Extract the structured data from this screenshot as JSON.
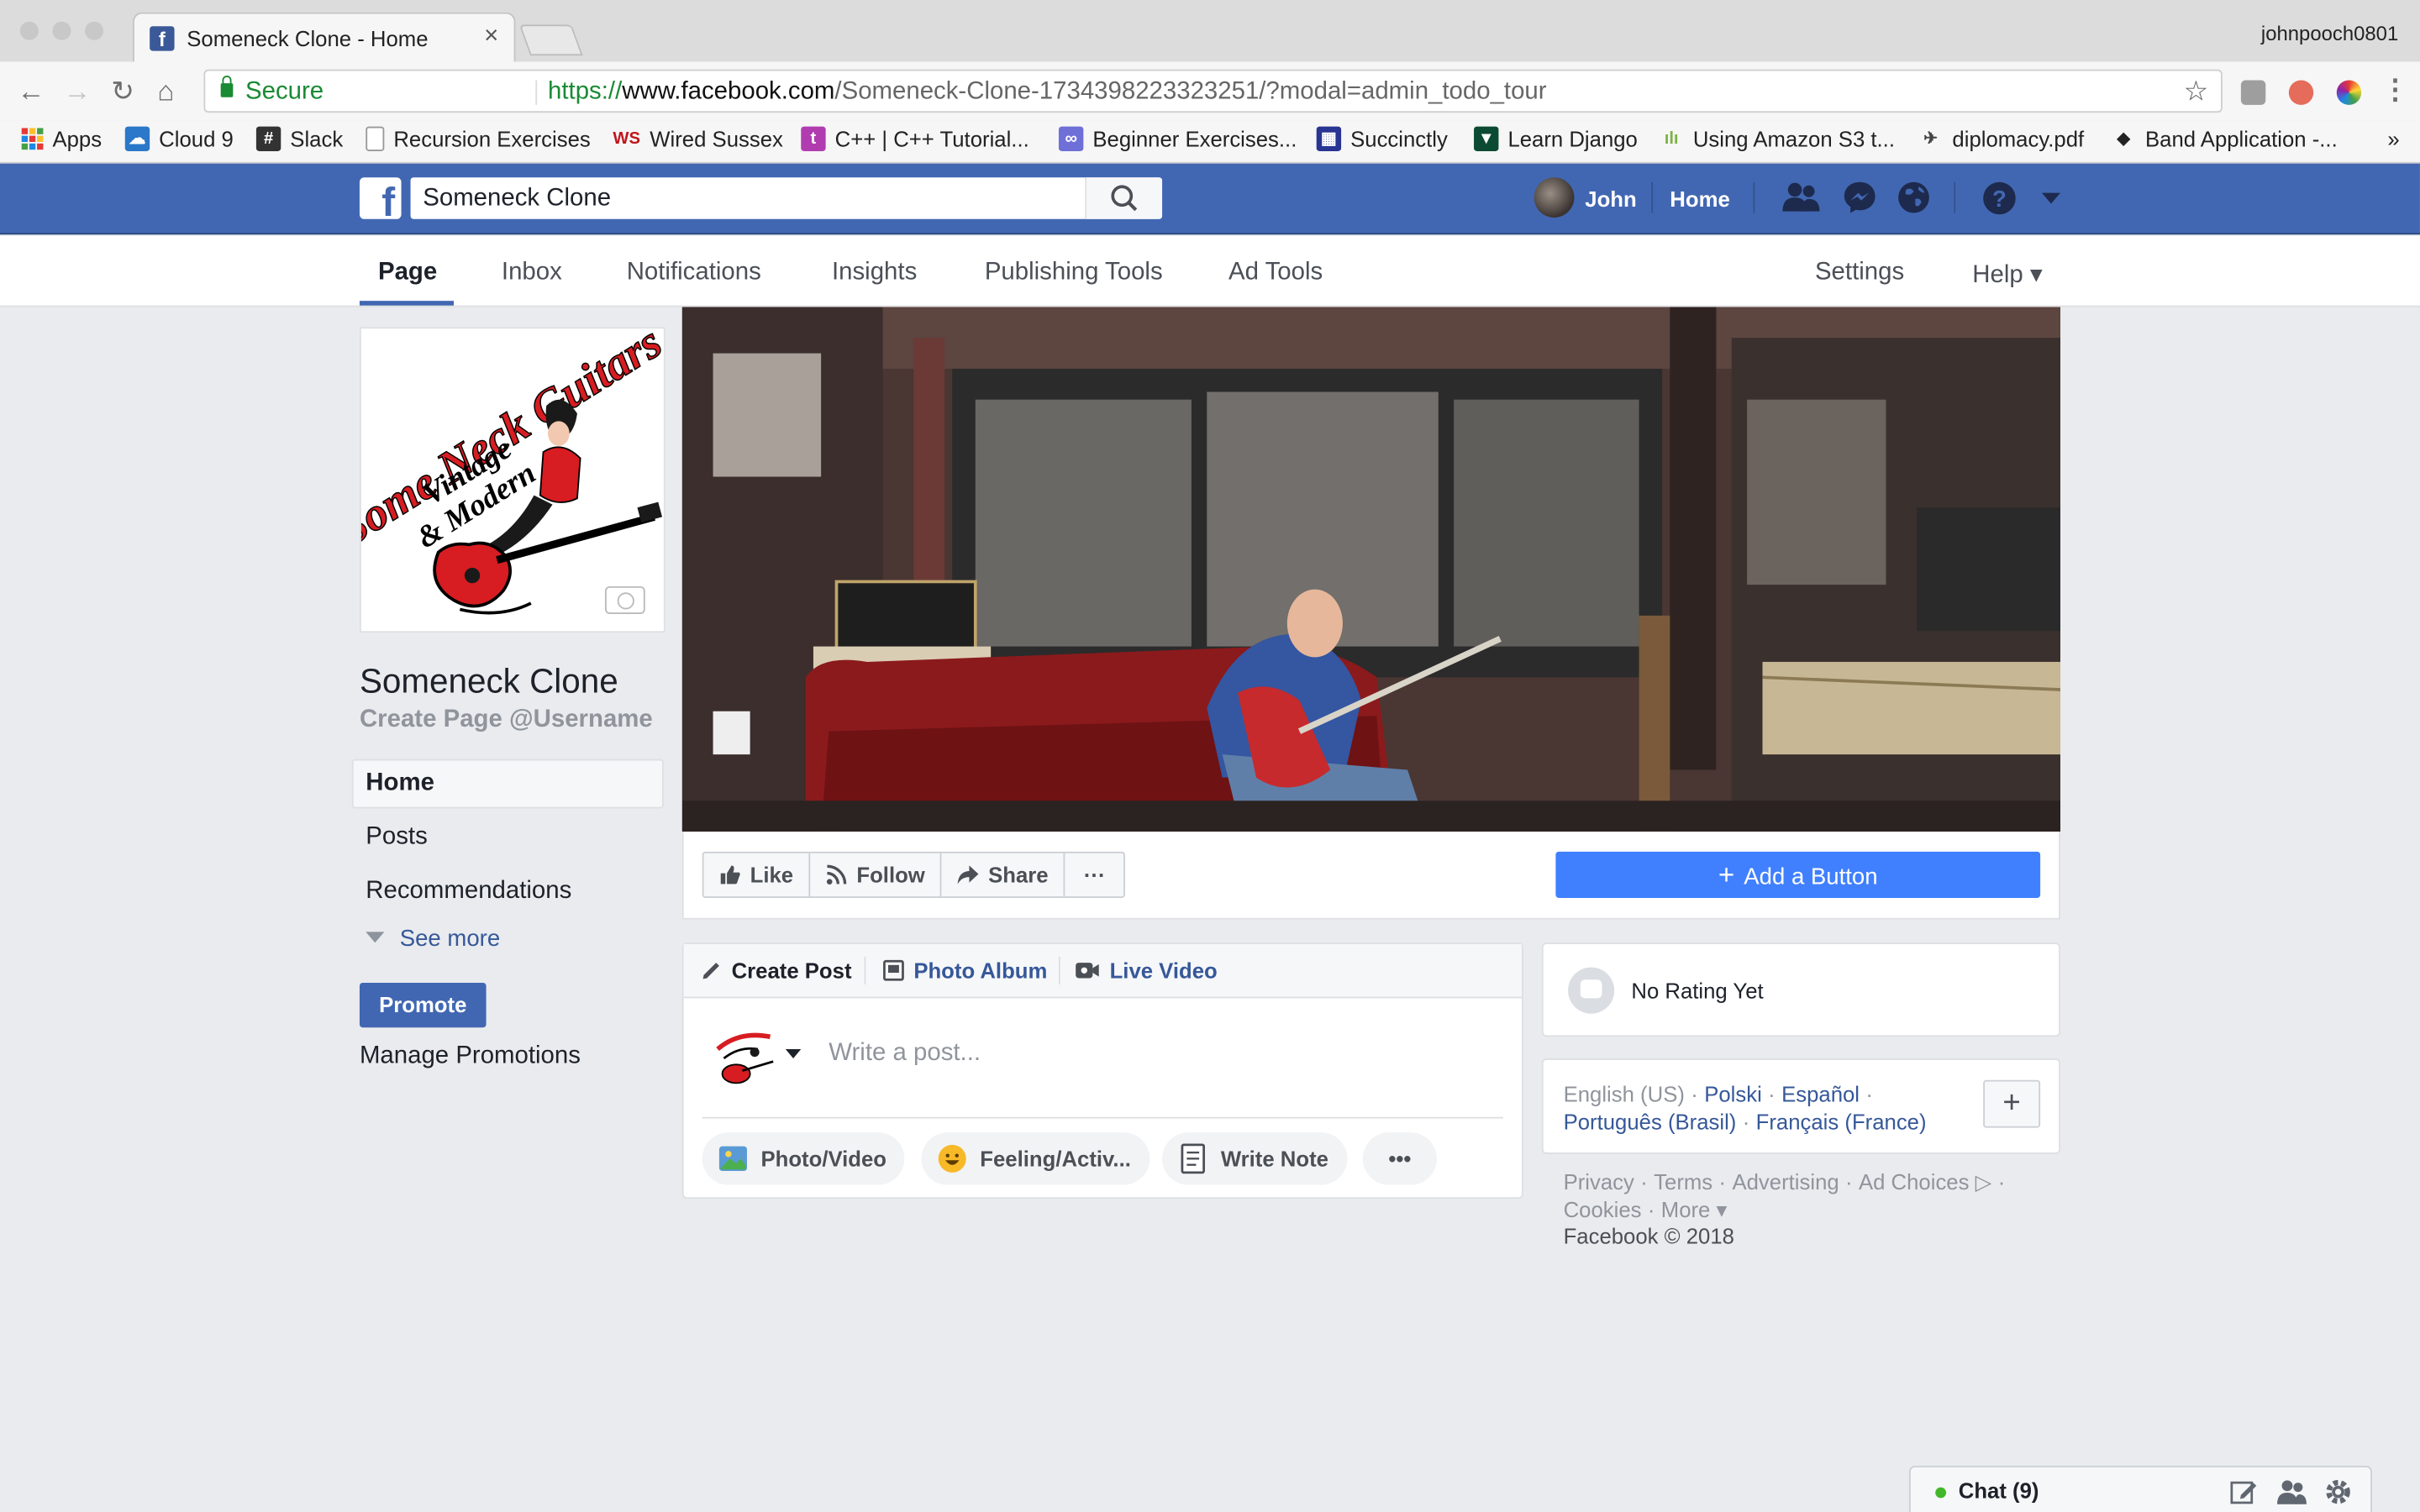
{
  "browser": {
    "tab_title": "Someneck Clone - Home",
    "profile_name": "johnpooch0801",
    "secure_label": "Secure",
    "url_scheme": "https://",
    "url_host": "www.facebook.com",
    "url_path": "/Someneck-Clone-1734398223323251/?modal=admin_todo_tour",
    "bookmarks": [
      {
        "label": "Apps",
        "icon": "apps-grid-icon",
        "color": "#e74c3c"
      },
      {
        "label": "Cloud 9",
        "icon": "cloud9-icon",
        "color": "#2b77c9"
      },
      {
        "label": "Slack",
        "icon": "slack-icon",
        "color": "#333333"
      },
      {
        "label": "Recursion Exercises",
        "icon": "page-icon",
        "color": "#ffffff"
      },
      {
        "label": "Wired Sussex",
        "icon": "ws-icon",
        "color": "#c0161d"
      },
      {
        "label": "C++ | C++ Tutorial...",
        "icon": "tutorial-icon",
        "color": "#b03cb0"
      },
      {
        "label": "Beginner Exercises...",
        "icon": "exercises-icon",
        "color": "#6f6fd8"
      },
      {
        "label": "Succinctly",
        "icon": "succinctly-icon",
        "color": "#283593"
      },
      {
        "label": "Learn Django",
        "icon": "django-icon",
        "color": "#0c4b33"
      },
      {
        "label": "Using Amazon S3 t...",
        "icon": "s3-icon",
        "color": "#7cb342"
      },
      {
        "label": "diplomacy.pdf",
        "icon": "pdf-icon",
        "color": "#444444"
      },
      {
        "label": "Band Application -...",
        "icon": "band-icon",
        "color": "#222222"
      }
    ],
    "bookmarks_overflow": "»"
  },
  "fb_header": {
    "search_value": "Someneck Clone",
    "user_name": "John",
    "home_label": "Home"
  },
  "page_nav": {
    "items": [
      "Page",
      "Inbox",
      "Notifications",
      "Insights",
      "Publishing Tools",
      "Ad Tools"
    ],
    "settings_label": "Settings",
    "help_label": "Help ▾"
  },
  "sidebar": {
    "page_name": "Someneck Clone",
    "username_cta": "Create Page @Username",
    "nav_items": [
      "Home",
      "Posts",
      "Recommendations"
    ],
    "see_more": "See more",
    "promote_label": "Promote",
    "manage_promotions": "Manage Promotions"
  },
  "logo": {
    "line1": "Some Neck Guitars",
    "line2": "Vintage",
    "line3": "& Modern"
  },
  "actions": {
    "like": "Like",
    "follow": "Follow",
    "share": "Share",
    "more": "···",
    "add_button": "Add a Button"
  },
  "composer": {
    "tab_create": "Create Post",
    "tab_album": "Photo Album",
    "tab_live": "Live Video",
    "placeholder": "Write a post...",
    "pills": [
      "Photo/Video",
      "Feeling/Activ...",
      "Write Note"
    ],
    "more": "•••"
  },
  "rating": {
    "text": "No Rating Yet"
  },
  "languages": {
    "current": "English (US)",
    "line1_links": [
      "Polski",
      "Español"
    ],
    "line2_links": [
      "Português (Brasil)",
      "Français (France)"
    ]
  },
  "footer": {
    "line1": [
      "Privacy",
      "Terms",
      "Advertising",
      "Ad Choices ▷"
    ],
    "line2": [
      "Cookies",
      "More ▾"
    ],
    "copyright": "Facebook © 2018"
  },
  "chat": {
    "label": "Chat (9)"
  },
  "colors": {
    "fb_blue": "#4267b2",
    "link": "#365899",
    "add_button": "#4080ff",
    "background": "#e9ebee"
  }
}
